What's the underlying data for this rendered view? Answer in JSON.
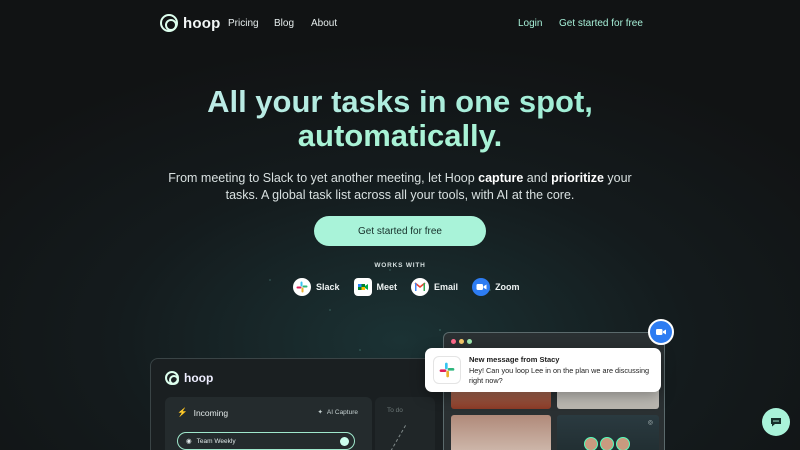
{
  "nav": {
    "brand": "hoop",
    "links": [
      "Pricing",
      "Blog",
      "About"
    ],
    "login": "Login",
    "cta": "Get started for free"
  },
  "hero": {
    "title_line1": "All your tasks in one spot,",
    "title_line2": "automatically.",
    "subtitle_line1_a": "From meeting to Slack to yet another meeting, let Hoop ",
    "subtitle_capture": "capture",
    "subtitle_and": " and ",
    "subtitle_prioritize": "prioritize",
    "subtitle_line1_b": " your",
    "subtitle_line2": "tasks. A global task list across all your tools, with AI at the core.",
    "cta": "Get started for free",
    "works_with": "WORKS WITH"
  },
  "integrations": [
    {
      "label": "Slack",
      "icon": "slack-icon"
    },
    {
      "label": "Meet",
      "icon": "google-meet-icon"
    },
    {
      "label": "Email",
      "icon": "gmail-icon"
    },
    {
      "label": "Zoom",
      "icon": "zoom-icon"
    }
  ],
  "app_preview": {
    "brand": "hoop",
    "incoming": "Incoming",
    "ai_capture": "AI Capture",
    "todo": "To do",
    "task": "Team Weekly"
  },
  "notification": {
    "title": "New message from Stacy",
    "message": "Hey! Can you loop Lee in on the plan we are discussing right now?"
  },
  "colors": {
    "accent": "#a9f3d9",
    "background": "#141b1d"
  }
}
